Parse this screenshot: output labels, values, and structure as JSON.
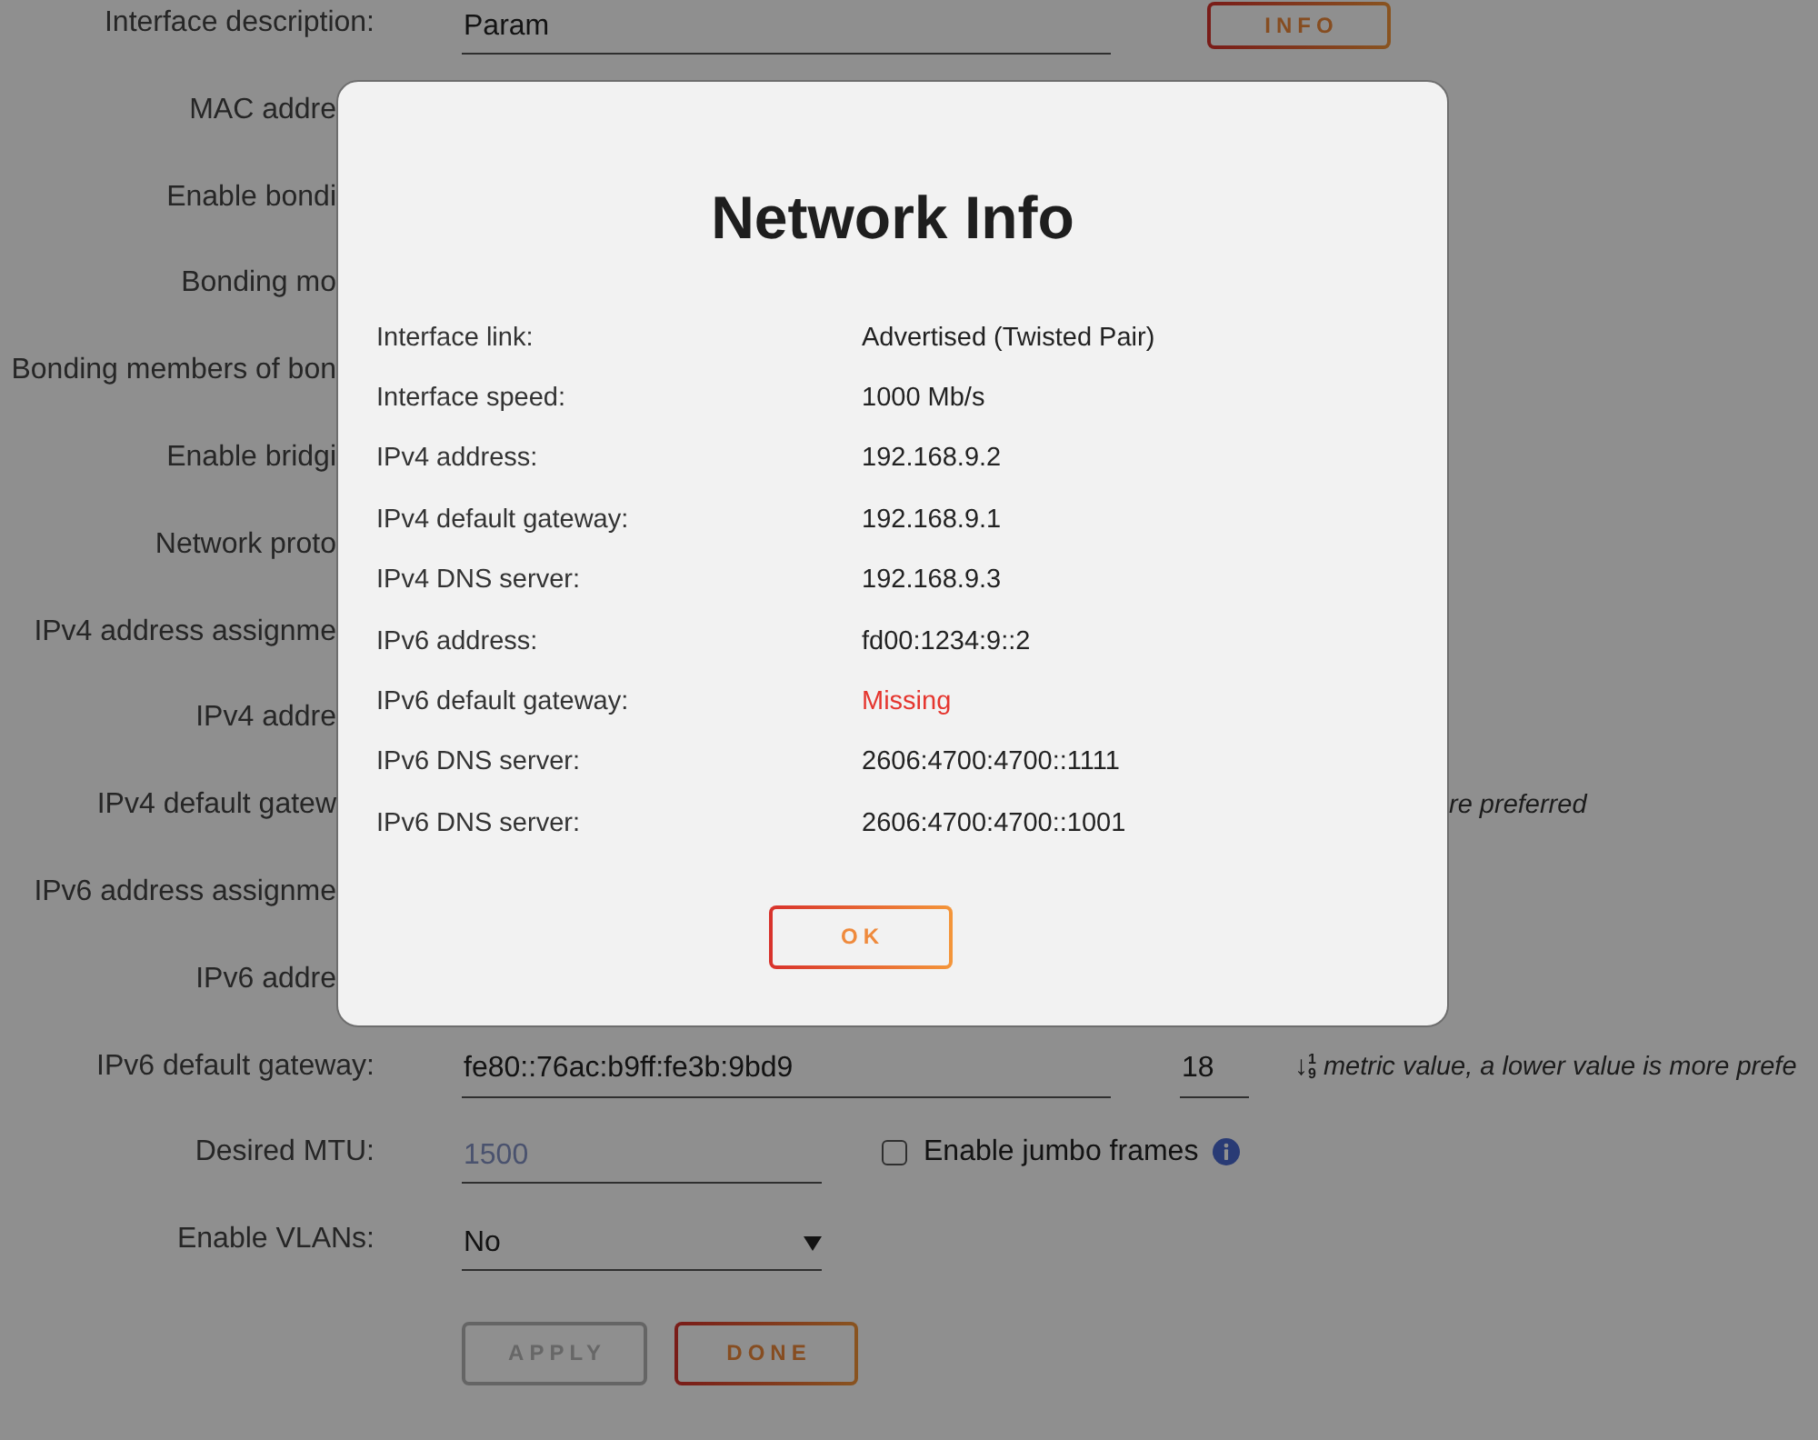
{
  "form": {
    "rows": [
      {
        "kind": "text",
        "label": "Interface description:",
        "value": "Param",
        "button": "INFO"
      },
      {
        "kind": "covered",
        "label": "MAC addre"
      },
      {
        "kind": "covered",
        "label": "Enable bondi"
      },
      {
        "kind": "covered",
        "label": "Bonding mo"
      },
      {
        "kind": "covered",
        "label": "Bonding members of bon"
      },
      {
        "kind": "covered",
        "label": "Enable bridgi"
      },
      {
        "kind": "covered",
        "label": "Network proto"
      },
      {
        "kind": "covered",
        "label": "IPv4 address assignme"
      },
      {
        "kind": "covered",
        "label": "IPv4 addre"
      },
      {
        "kind": "covered",
        "label": "IPv4 default gatew",
        "hint": "re preferred"
      },
      {
        "kind": "covered",
        "label": "IPv6 address assignme"
      },
      {
        "kind": "covered",
        "label": "IPv6 addre"
      },
      {
        "kind": "text",
        "label": "IPv6 default gateway:",
        "value": "fe80::76ac:b9ff:fe3b:9bd9",
        "metric": "18",
        "sort_icon": {
          "arrow": "↓",
          "upper": "1",
          "lower": "9"
        },
        "hint": "metric value, a lower value is more prefe"
      },
      {
        "kind": "number",
        "label": "Desired MTU:",
        "placeholder": "1500",
        "checkbox": {
          "label": "Enable jumbo frames",
          "checked": false
        }
      },
      {
        "kind": "select",
        "label": "Enable VLANs:",
        "value": "No"
      }
    ],
    "buttons": [
      {
        "label": "APPLY",
        "disabled": true
      },
      {
        "label": "DONE",
        "disabled": false
      }
    ]
  },
  "dialog": {
    "title": "Network Info",
    "rows": [
      {
        "label": "Interface link:",
        "value": "Advertised (Twisted Pair)",
        "alert": false
      },
      {
        "label": "Interface speed:",
        "value": "1000 Mb/s",
        "alert": false
      },
      {
        "label": "IPv4 address:",
        "value": "192.168.9.2",
        "alert": false
      },
      {
        "label": "IPv4 default gateway:",
        "value": "192.168.9.1",
        "alert": false
      },
      {
        "label": "IPv4 DNS server:",
        "value": "192.168.9.3",
        "alert": false
      },
      {
        "label": "IPv6 address:",
        "value": "fd00:1234:9::2",
        "alert": false
      },
      {
        "label": "IPv6 default gateway:",
        "value": "Missing",
        "alert": true
      },
      {
        "label": "IPv6 DNS server:",
        "value": "2606:4700:4700::1111",
        "alert": false
      },
      {
        "label": "IPv6 DNS server:",
        "value": "2606:4700:4700::1001",
        "alert": false
      }
    ],
    "button": "OK"
  }
}
